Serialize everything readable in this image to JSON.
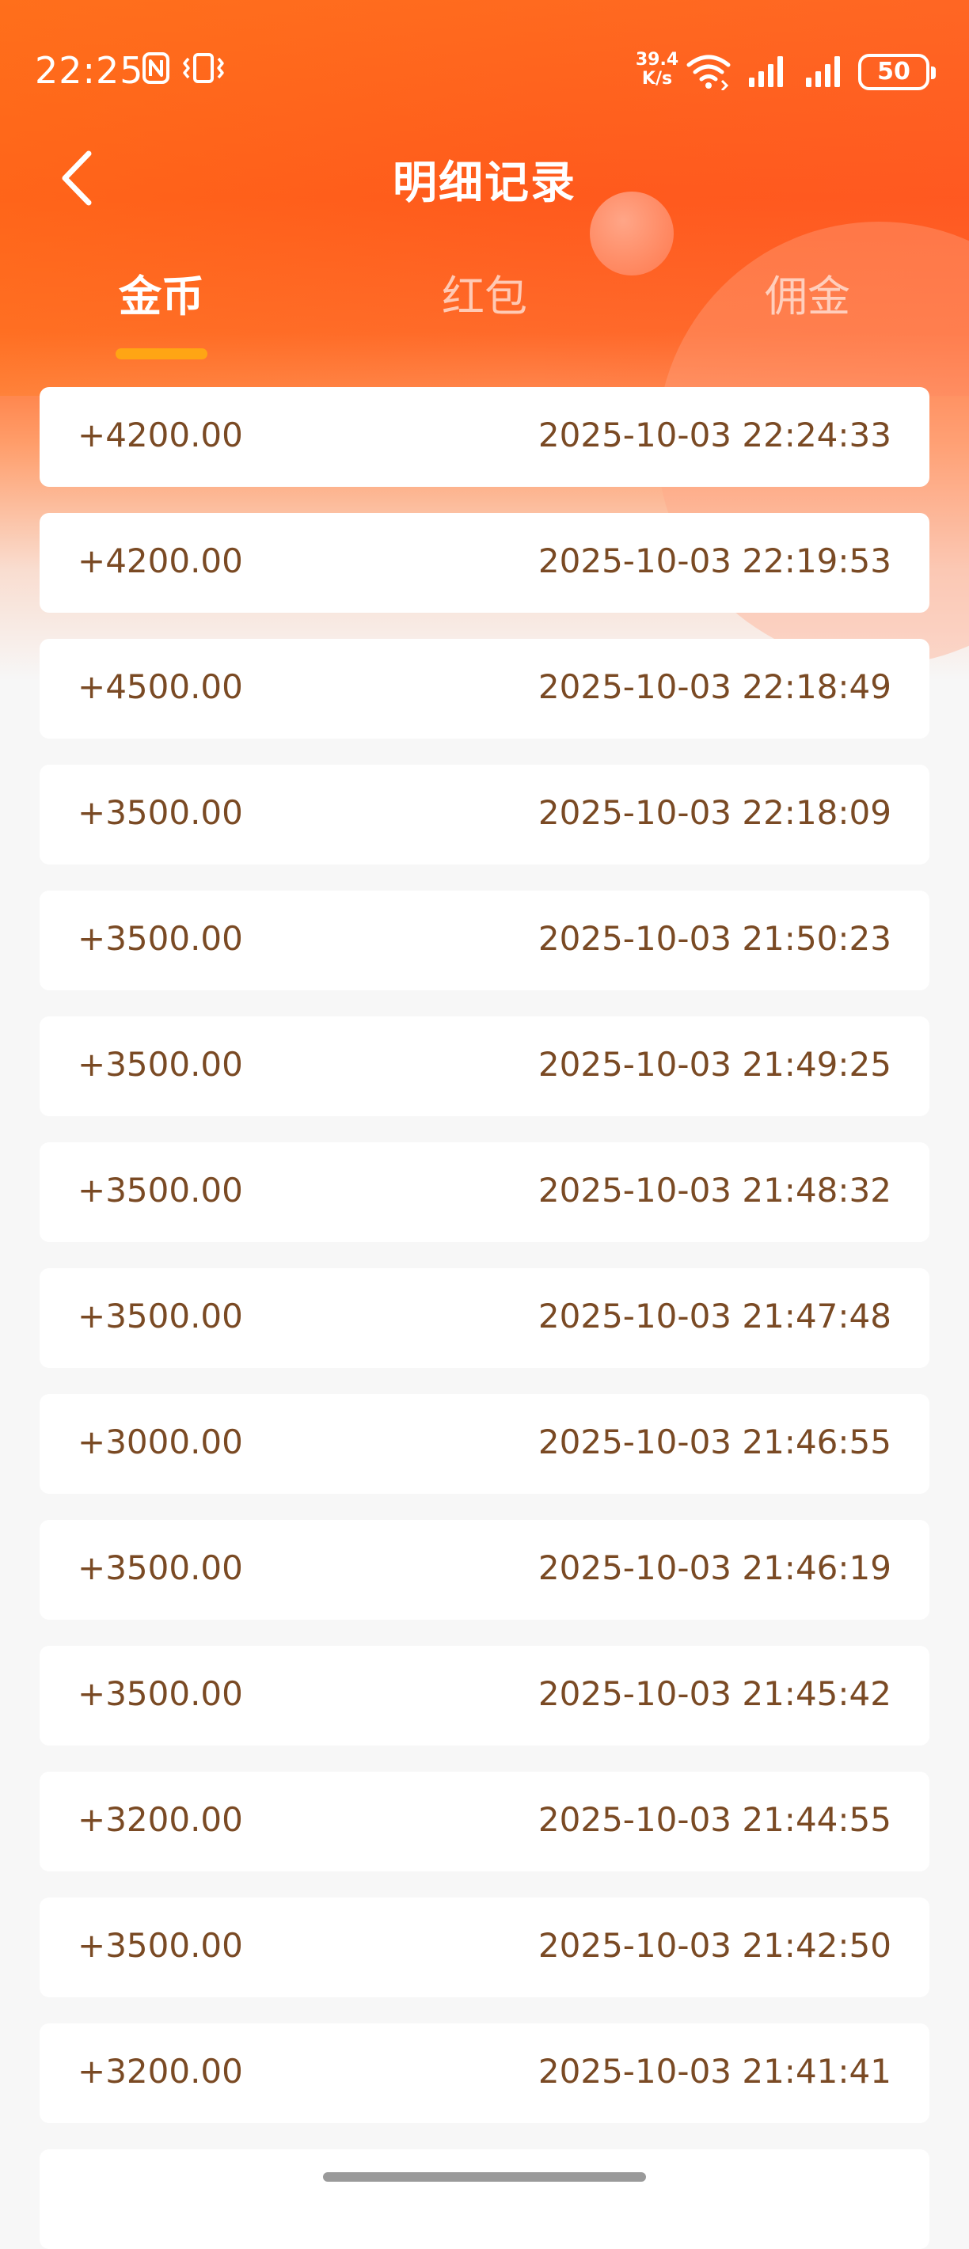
{
  "status_bar": {
    "time": "22:25",
    "network_speed_value": "39.4",
    "network_speed_unit": "K/s",
    "battery": "50",
    "icons": [
      "nfc-icon",
      "vibrate-icon",
      "wifi-icon",
      "signal-icon",
      "signal-icon",
      "battery-icon"
    ]
  },
  "nav": {
    "back_icon": "chevron-left-icon",
    "title": "明细记录"
  },
  "tabs": [
    {
      "label": "金币",
      "active": true
    },
    {
      "label": "红包",
      "active": false
    },
    {
      "label": "佣金",
      "active": false
    }
  ],
  "colors": {
    "header_orange": "#ff5a1c",
    "tab_indicator": "#ffa514",
    "record_text": "#7a4a24",
    "card_bg": "#ffffff",
    "page_bg": "#f7f7f7"
  },
  "records": [
    {
      "amount": "+4200.00",
      "time": "2025-10-03 22:24:33"
    },
    {
      "amount": "+4200.00",
      "time": "2025-10-03 22:19:53"
    },
    {
      "amount": "+4500.00",
      "time": "2025-10-03 22:18:49"
    },
    {
      "amount": "+3500.00",
      "time": "2025-10-03 22:18:09"
    },
    {
      "amount": "+3500.00",
      "time": "2025-10-03 21:50:23"
    },
    {
      "amount": "+3500.00",
      "time": "2025-10-03 21:49:25"
    },
    {
      "amount": "+3500.00",
      "time": "2025-10-03 21:48:32"
    },
    {
      "amount": "+3500.00",
      "time": "2025-10-03 21:47:48"
    },
    {
      "amount": "+3000.00",
      "time": "2025-10-03 21:46:55"
    },
    {
      "amount": "+3500.00",
      "time": "2025-10-03 21:46:19"
    },
    {
      "amount": "+3500.00",
      "time": "2025-10-03 21:45:42"
    },
    {
      "amount": "+3200.00",
      "time": "2025-10-03 21:44:55"
    },
    {
      "amount": "+3500.00",
      "time": "2025-10-03 21:42:50"
    },
    {
      "amount": "+3200.00",
      "time": "2025-10-03 21:41:41"
    },
    {
      "amount": "",
      "time": ""
    }
  ]
}
